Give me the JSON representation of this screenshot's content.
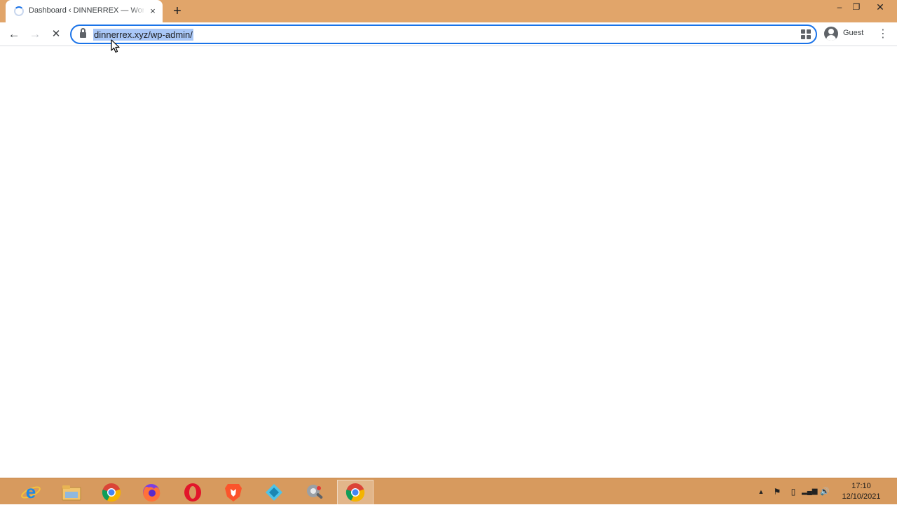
{
  "browser": {
    "tab": {
      "title": "Dashboard ‹ DINNERREX — WordPress",
      "close_icon": "×"
    },
    "new_tab_icon": "+",
    "window_controls": {
      "minimize": "–",
      "maximize": "❐",
      "close": "✕"
    },
    "toolbar": {
      "back_icon": "←",
      "forward_icon": "→",
      "stop_icon": "✕",
      "url": "dinnerrex.xyz/wp-admin/",
      "profile_label": "Guest",
      "menu_icon": "⋮"
    }
  },
  "taskbar": {
    "apps": [
      "internet-explorer",
      "file-explorer",
      "chrome",
      "firefox",
      "opera",
      "brave",
      "vpn-app",
      "tool-app",
      "chrome-active"
    ],
    "tray": {
      "overflow_icon": "▲",
      "flag_icon": "⚑",
      "battery_icon": "▯",
      "signal_icon": "▂▄▆",
      "volume_icon": "🔊"
    },
    "clock": {
      "time": "17:10",
      "date": "12/10/2021"
    }
  }
}
